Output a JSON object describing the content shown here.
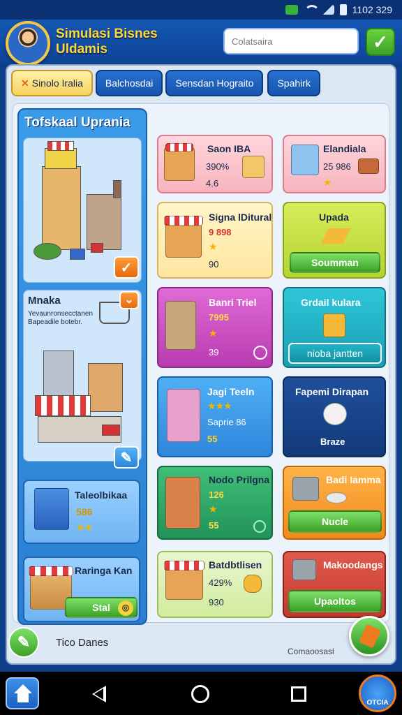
{
  "status_bar": {
    "time": "1102 329"
  },
  "header": {
    "title_line1": "Simulasi Bisnes",
    "title_line2": "Uldamis",
    "search_placeholder": "Colatsaira"
  },
  "tabs": [
    {
      "label": "Sinolo Iralia",
      "active": true
    },
    {
      "label": "Balchosdai",
      "active": false
    },
    {
      "label": "Sensdan Hograito",
      "active": false
    },
    {
      "label": "Spahirk",
      "active": false
    }
  ],
  "left_panel": {
    "title": "Tofskaal Uprania",
    "section2_title": "Mnaka",
    "section2_desc": "Yevaunronsecctanen Bapeadile botebr.",
    "mini_card1": {
      "title": "Taleolbikaa",
      "value": "586"
    },
    "mini_card2": {
      "title": "Raringa Kan",
      "button": "Stal"
    }
  },
  "cards": [
    {
      "name": "Saon IBA",
      "line1": "390%",
      "line2": "4.6"
    },
    {
      "name": "Elandiala",
      "line1": "25 986"
    },
    {
      "name": "Signa lDitural",
      "line1": "9 898",
      "line2": "90"
    },
    {
      "name": "Upada",
      "button": "Soumman"
    },
    {
      "name": "Banri Triel",
      "line1": "7995",
      "line2": "39"
    },
    {
      "name": "Grdail kulara",
      "button": "nioba jantten"
    },
    {
      "name": "Jagi Teeln",
      "line1": "Saprie 86",
      "line2": "55"
    },
    {
      "name": "Fapemi Dirapan",
      "button": "Braze"
    },
    {
      "name": "Nodo Prilgna",
      "line1": "126",
      "line2": "55"
    },
    {
      "name": "Badi Iamma",
      "button": "Nucle"
    },
    {
      "name": "Batdbtlisen",
      "line1": "429%",
      "line2": "930"
    },
    {
      "name": "Makoodangs",
      "button": "Upaoltos"
    }
  ],
  "footer": {
    "label": "Tico Danes",
    "right": "Comaoosasl"
  },
  "nav": {
    "shop_label": "OTCIA"
  },
  "colors": {
    "header": "#1557b3",
    "accent_gold": "#ffd83d",
    "confirm_green": "#3aa226"
  }
}
